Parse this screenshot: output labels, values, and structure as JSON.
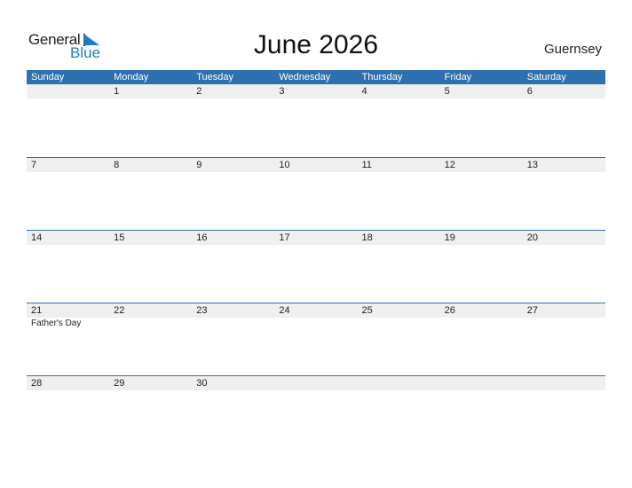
{
  "logo": {
    "line1": "General",
    "line2": "Blue"
  },
  "title": "June 2026",
  "country": "Guernsey",
  "colors": {
    "accent": "#2e6fb0",
    "logo_blue": "#1f7ac6",
    "row_bg": "#efefef"
  },
  "weekdays": [
    "Sunday",
    "Monday",
    "Tuesday",
    "Wednesday",
    "Thursday",
    "Friday",
    "Saturday"
  ],
  "weeks": [
    {
      "days": [
        "",
        "1",
        "2",
        "3",
        "4",
        "5",
        "6"
      ],
      "events": [
        "",
        "",
        "",
        "",
        "",
        "",
        ""
      ]
    },
    {
      "days": [
        "7",
        "8",
        "9",
        "10",
        "11",
        "12",
        "13"
      ],
      "events": [
        "",
        "",
        "",
        "",
        "",
        "",
        ""
      ]
    },
    {
      "days": [
        "14",
        "15",
        "16",
        "17",
        "18",
        "19",
        "20"
      ],
      "events": [
        "",
        "",
        "",
        "",
        "",
        "",
        ""
      ]
    },
    {
      "days": [
        "21",
        "22",
        "23",
        "24",
        "25",
        "26",
        "27"
      ],
      "events": [
        "Father's Day",
        "",
        "",
        "",
        "",
        "",
        ""
      ]
    },
    {
      "days": [
        "28",
        "29",
        "30",
        "",
        "",
        "",
        ""
      ],
      "events": [
        "",
        "",
        "",
        "",
        "",
        "",
        ""
      ]
    }
  ]
}
